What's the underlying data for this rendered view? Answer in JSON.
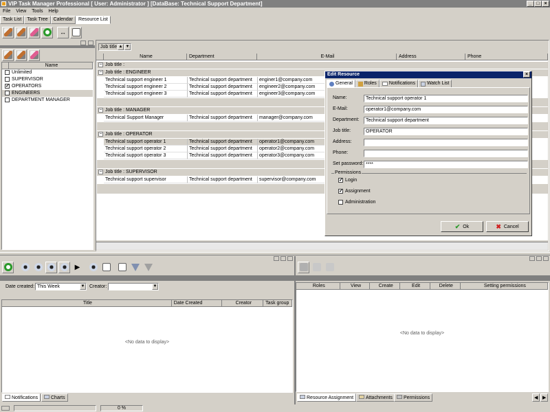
{
  "window": {
    "title": "VIP Task Manager Professional [ User: Administrator ] [DataBase: Technical Support Department]",
    "controls": {
      "minimize": "_",
      "maximize": "□",
      "close": "×"
    }
  },
  "menu": [
    "File",
    "View",
    "Tools",
    "Help"
  ],
  "tabs": [
    "Task List",
    "Task Tree",
    "Calendar",
    "Resource List"
  ],
  "left_panel": {
    "header": "Name",
    "groups": [
      {
        "label": "Unlimited",
        "checked": false
      },
      {
        "label": "SUPERVISOR",
        "checked": false
      },
      {
        "label": "OPERATORS",
        "checked": true
      },
      {
        "label": "ENGINEERS",
        "checked": false
      },
      {
        "label": "DEPARTMENT MANAGER",
        "checked": false
      }
    ]
  },
  "resource_grid": {
    "group_by": "Job title",
    "columns": [
      "Name",
      "Department",
      "E-Mail",
      "Address",
      "Phone"
    ],
    "top_group": "Job title :",
    "groups": [
      {
        "title": "Job title : ENGINEER",
        "rows": [
          [
            "Technical support engineer 1",
            "Technical support department",
            "enginer1@company.com"
          ],
          [
            "Technical support engineer 2",
            "Technical support department",
            "engineer2@company.com"
          ],
          [
            "Technical support engineer 3",
            "Technical support department",
            "engineer3@company.com"
          ]
        ]
      },
      {
        "title": "Job title : MANAGER",
        "rows": [
          [
            "Technical Support Manager",
            "Technical support department",
            "manager@company.com"
          ]
        ]
      },
      {
        "title": "Job title : OPERATOR",
        "rows": [
          [
            "Technical support operator 1",
            "Technical support department",
            "operator1@company.com"
          ],
          [
            "Technical support operator 2",
            "Technical support department",
            "operator2@company.com"
          ],
          [
            "Technical support operator 3",
            "Technical support department",
            "operator3@company.com"
          ]
        ]
      },
      {
        "title": "Job title : SUPERVISOR",
        "rows": [
          [
            "Technical support supervisor",
            "Technical support department",
            "supervisor@company.com"
          ]
        ]
      }
    ]
  },
  "dialog": {
    "title": "Edit Resource",
    "tabs": [
      "General",
      "Roles",
      "Notifications",
      "Watch List"
    ],
    "fields": {
      "name": {
        "label": "Name:",
        "value": "Technical support operator 1"
      },
      "email": {
        "label": "E-Mail:",
        "value": "operator1@company.com"
      },
      "department": {
        "label": "Department:",
        "value": "Technical support department"
      },
      "job_title": {
        "label": "Job title:",
        "value": "OPERATOR"
      },
      "address": {
        "label": "Address:",
        "value": ""
      },
      "phone": {
        "label": "Phone:",
        "value": ""
      },
      "password": {
        "label": "Set password:",
        "value": "****"
      }
    },
    "permissions": {
      "legend": "Permissions",
      "items": [
        {
          "label": "Login",
          "checked": true
        },
        {
          "label": "Assignment",
          "checked": true
        },
        {
          "label": "Administration",
          "checked": false
        }
      ]
    },
    "ok_label": "Ok",
    "cancel_label": "Cancel"
  },
  "tasks_panel": {
    "date_created_label": "Date created:",
    "date_created_value": "This Week",
    "creator_label": "Creator:",
    "creator_value": "",
    "columns": [
      "Title",
      "Date Created",
      "Creator",
      "Task group"
    ],
    "empty_text": "<No data to display>"
  },
  "roles_panel": {
    "columns": [
      "Roles",
      "View",
      "Create",
      "Edit",
      "Delete",
      "Setting permissions"
    ],
    "empty_text": "<No data to display>"
  },
  "bottom_tabs_left": [
    "Notifications",
    "Charts"
  ],
  "bottom_tabs_right": [
    "Resource Assignment",
    "Attachments",
    "Permissions"
  ],
  "status": {
    "progress": "0 %"
  },
  "colors": {
    "dialog_title": "#0a246a",
    "selected_row": "#d4d0c8",
    "accent_green": "#2a9a2a"
  }
}
